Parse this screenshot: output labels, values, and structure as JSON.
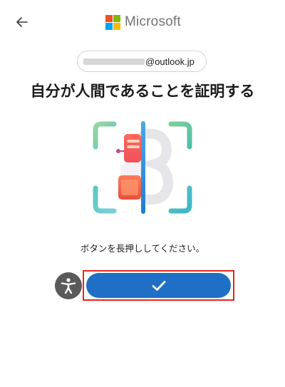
{
  "header": {
    "back_icon": "arrow-left-icon",
    "brand_name": "Microsoft",
    "logo_colors": [
      "#f25022",
      "#7fba00",
      "#00a4ef",
      "#ffb900"
    ]
  },
  "account": {
    "email_visible_part": "@outlook.jp"
  },
  "main": {
    "title": "自分が人間であることを証明する",
    "instruction": "ボタンを長押ししてください。",
    "illustration_icon": "human-verification-scan-icon"
  },
  "actions": {
    "accessibility_icon": "accessibility-person-icon",
    "hold_button_icon": "checkmark-icon"
  },
  "colors": {
    "primary_button": "#1f6fc6",
    "highlight_border": "#e0281f",
    "accessibility_button": "#5a5a5a"
  }
}
